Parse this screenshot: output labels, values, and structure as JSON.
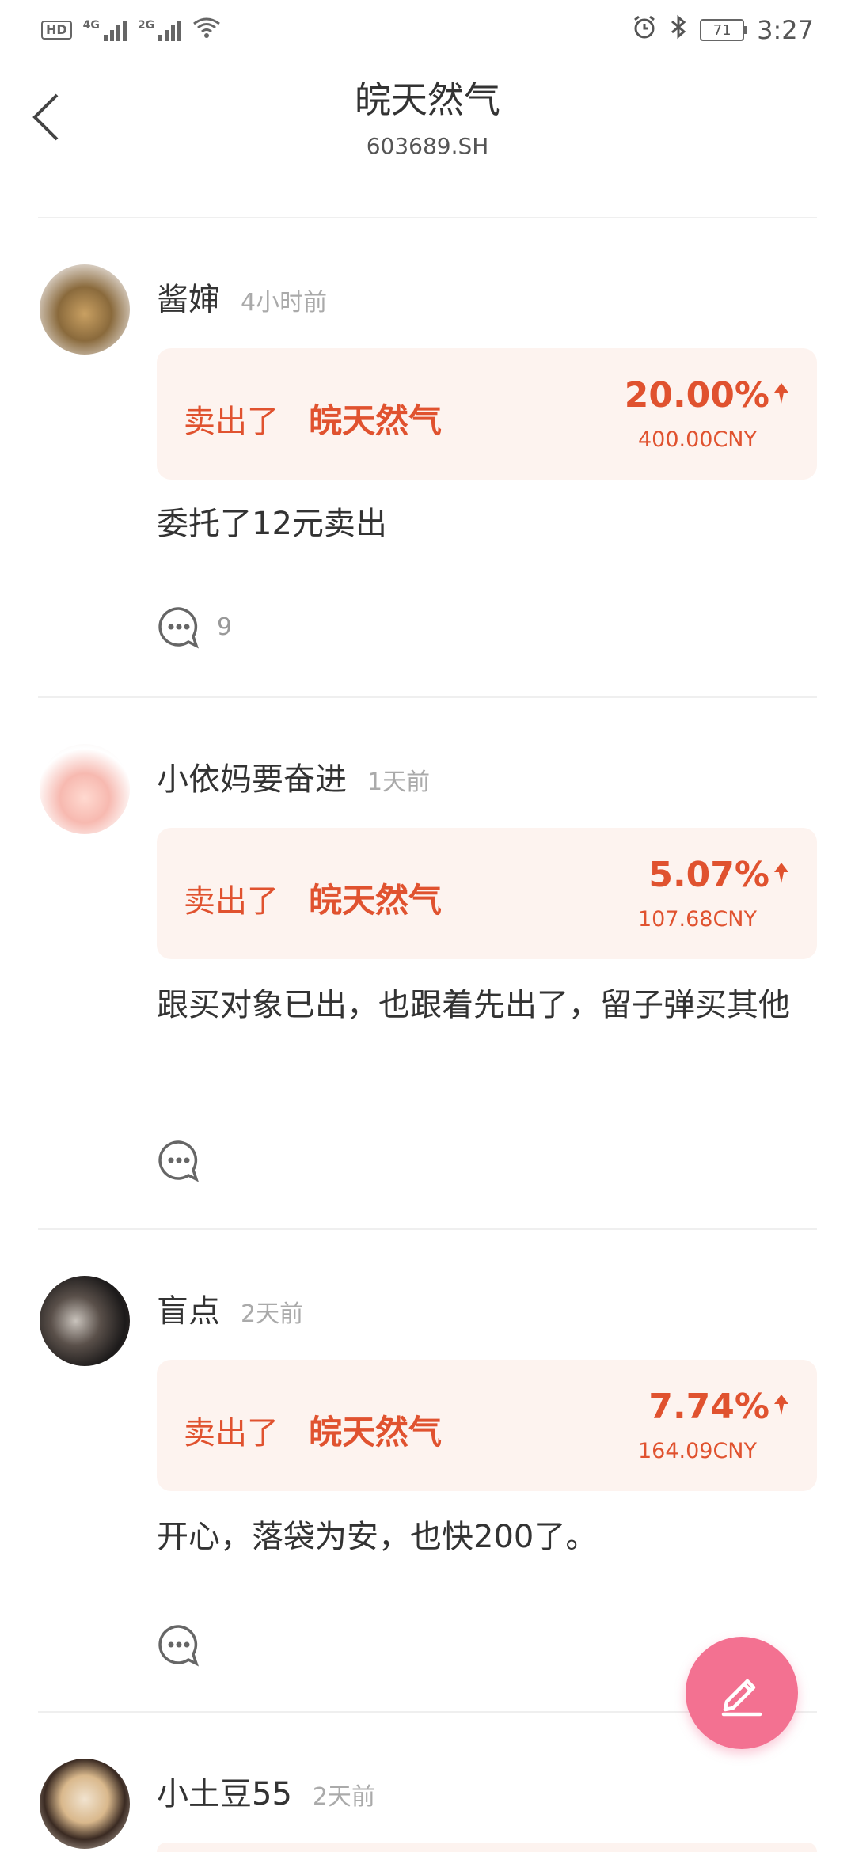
{
  "status_bar": {
    "hd": "HD",
    "net1": "4G",
    "net2": "2G",
    "battery": "71",
    "time": "3:27",
    "icons": [
      "hd-icon",
      "signal-icon",
      "wifi-icon",
      "alarm-icon",
      "bluetooth-icon",
      "battery-icon"
    ]
  },
  "header": {
    "title": "皖天然气",
    "code": "603689.SH"
  },
  "accent_color": "#e0522f",
  "fab_color": "#f37191",
  "posts": [
    {
      "user": "酱婶",
      "time": "4小时前",
      "action": "卖出了",
      "stock": "皖天然气",
      "pct": "20.00%",
      "amount": "400.00CNY",
      "text": "委托了12元卖出",
      "comments": "9"
    },
    {
      "user": "小依妈要奋进",
      "time": "1天前",
      "action": "卖出了",
      "stock": "皖天然气",
      "pct": "5.07%",
      "amount": "107.68CNY",
      "text": "跟买对象已出，也跟着先出了，留子弹买其他",
      "comments": ""
    },
    {
      "user": "盲点",
      "time": "2天前",
      "action": "卖出了",
      "stock": "皖天然气",
      "pct": "7.74%",
      "amount": "164.09CNY",
      "text": "开心，落袋为安，也快200了。",
      "comments": ""
    },
    {
      "user": "小土豆55",
      "time": "2天前"
    }
  ]
}
